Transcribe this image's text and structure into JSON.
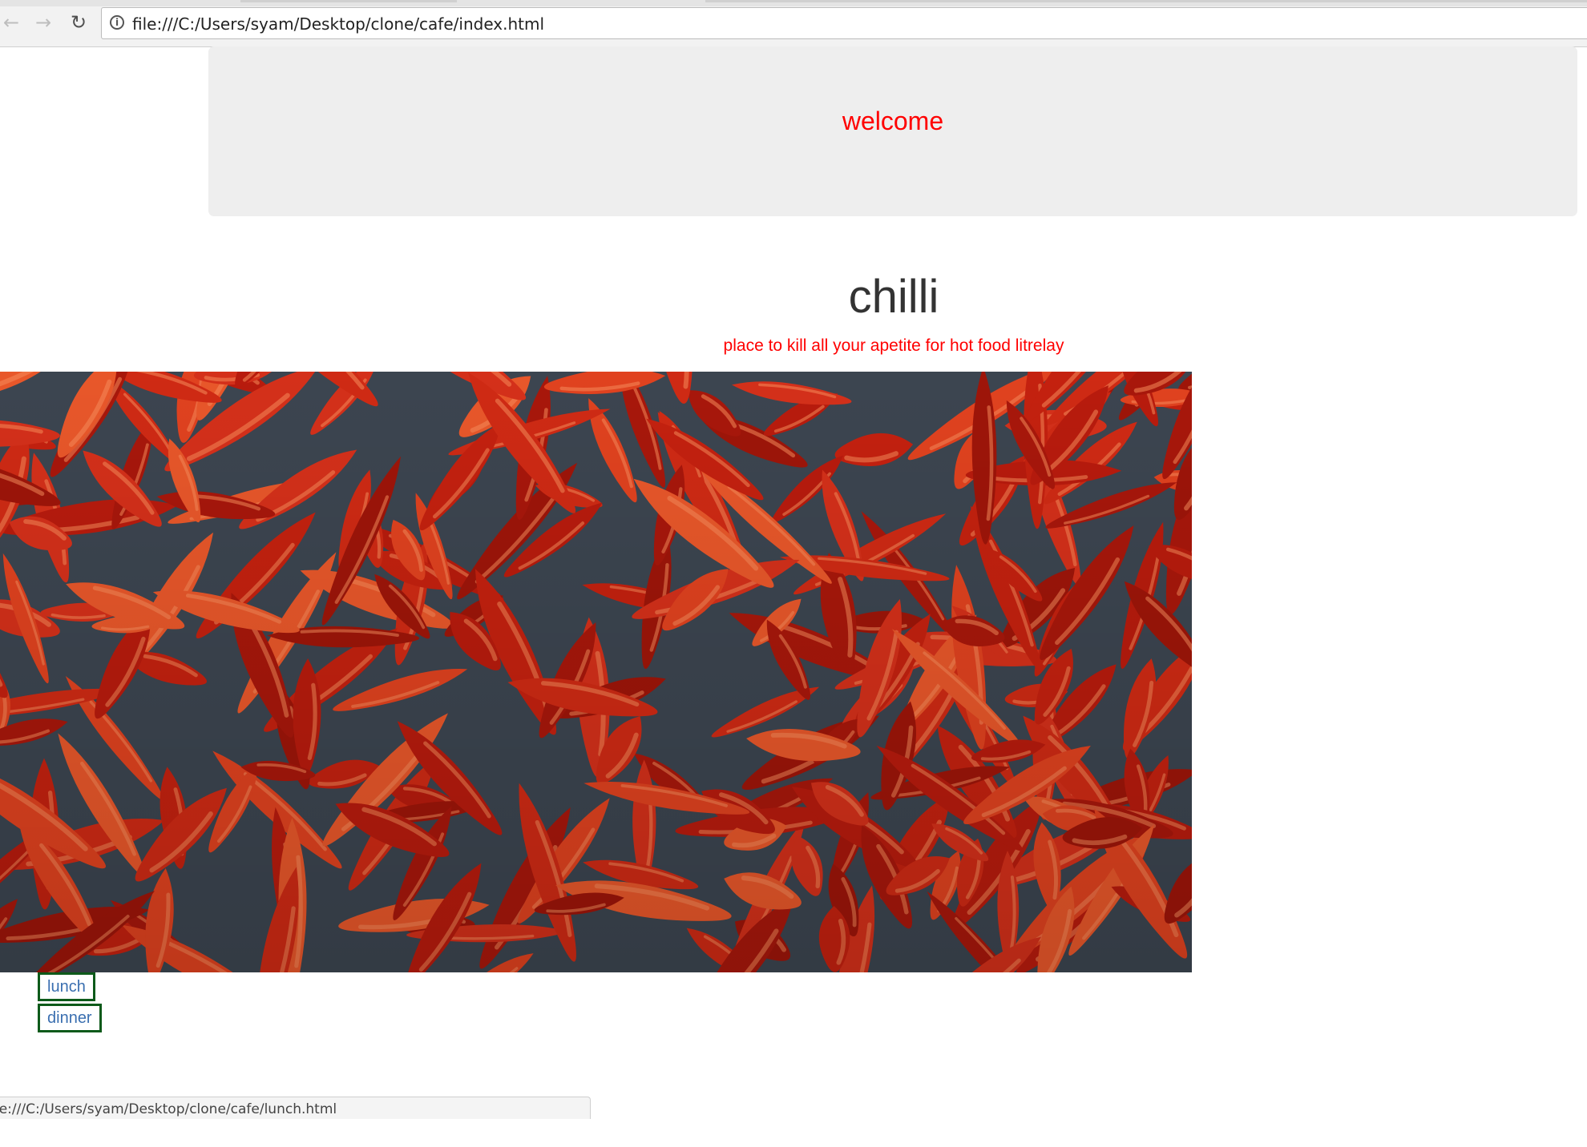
{
  "browser": {
    "address_bar": {
      "url": "file:///C:/Users/syam/Desktop/clone/cafe/index.html"
    },
    "status_bar": {
      "text": "le:///C:/Users/syam/Desktop/clone/cafe/lunch.html"
    },
    "icons": [
      "back-arrow-icon",
      "forward-arrow-icon",
      "reload-icon",
      "info-icon"
    ]
  },
  "page": {
    "jumbotron": {
      "text": "welcome"
    },
    "brand": {
      "title": "chilli",
      "tagline": "place to kill all your apetite for hot food litrelay"
    },
    "hero_image": {
      "subject": "dried red chilli peppers"
    },
    "menu_links": [
      {
        "label": "lunch"
      },
      {
        "label": "dinner"
      }
    ]
  },
  "colors": {
    "accent_red": "#ff0000",
    "jumbotron_bg": "#eeeeee",
    "link_border": "#0d5a1a",
    "link_text": "#3a6fb0",
    "title_text": "#333333"
  }
}
